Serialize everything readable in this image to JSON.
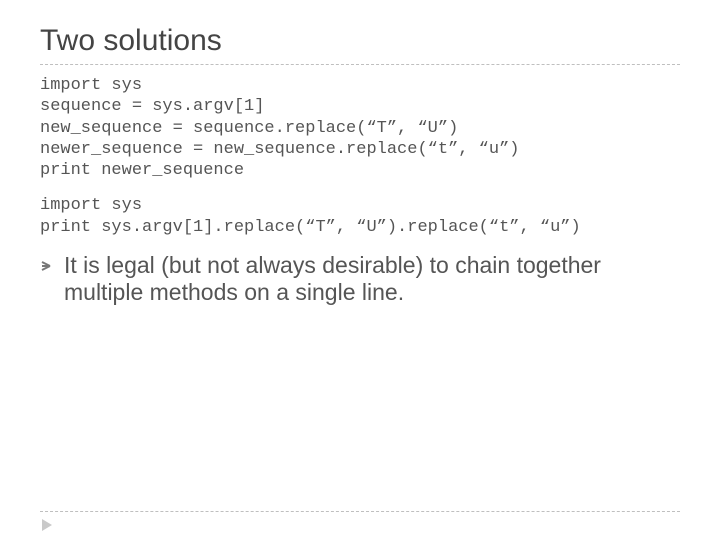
{
  "title": "Two solutions",
  "code_block_1": "import sys\nsequence = sys.argv[1]\nnew_sequence = sequence.replace(“T”, “U”)\nnewer_sequence = new_sequence.replace(“t”, “u”)\nprint newer_sequence",
  "code_block_2": "import sys\nprint sys.argv[1].replace(“T”, “U”).replace(“t”, “u”)",
  "bullet_text": "It is legal (but not always desirable) to chain together multiple methods on a single line."
}
